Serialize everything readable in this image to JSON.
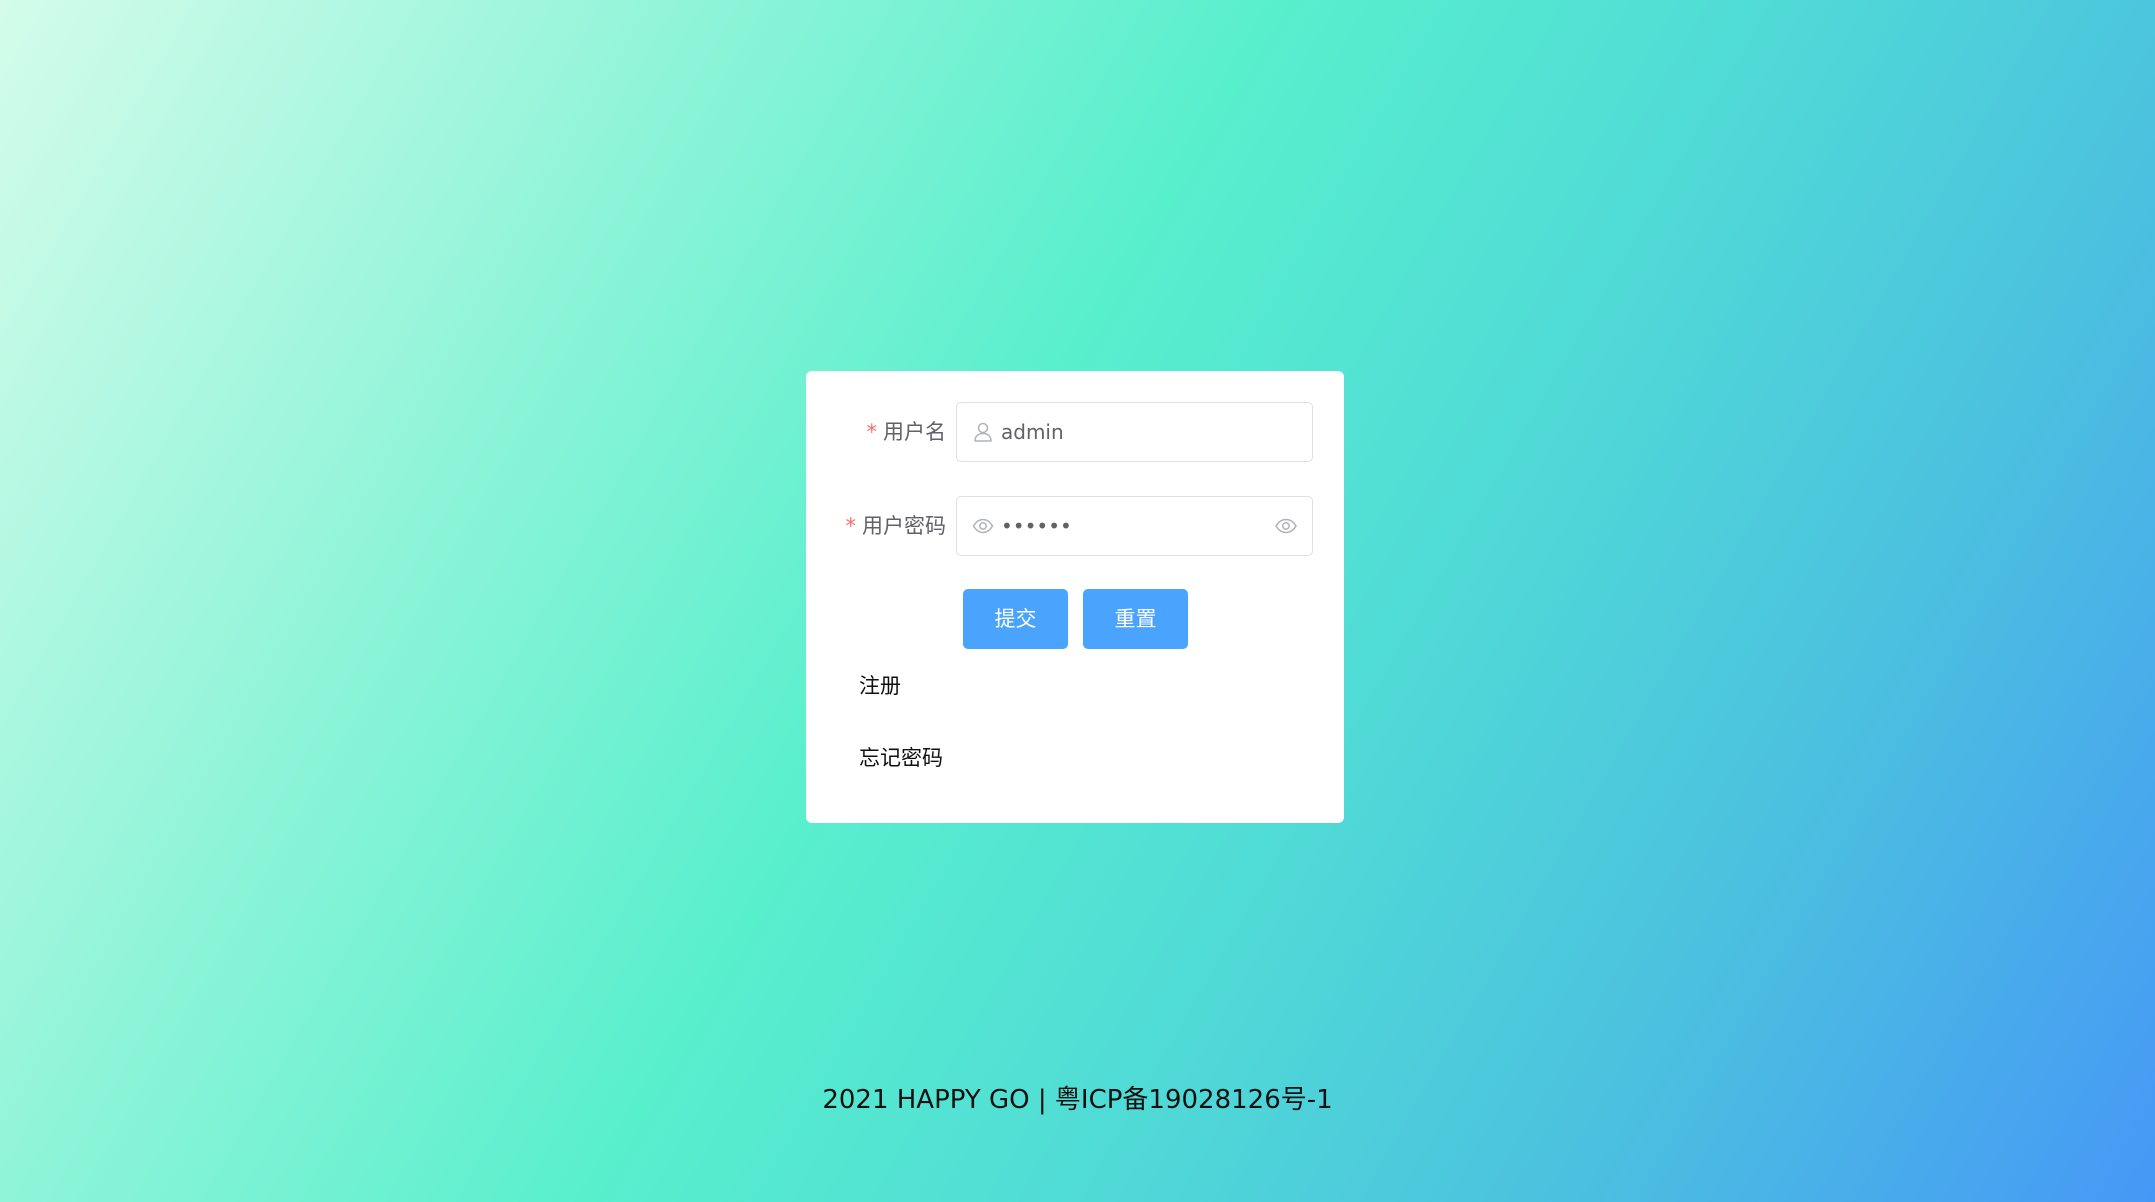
{
  "login_form": {
    "username": {
      "required_mark": "*",
      "label": "用户名",
      "value": "admin",
      "prefix_icon": "user-icon"
    },
    "password": {
      "required_mark": "*",
      "label": "用户密码",
      "value": "123456",
      "prefix_icon": "eye-icon",
      "suffix_icon": "eye-icon"
    },
    "buttons": {
      "submit_label": "提交",
      "reset_label": "重置"
    },
    "links": {
      "register_label": "注册",
      "forgot_password_label": "忘记密码"
    }
  },
  "footer": {
    "text": "2021 HAPPY GO | 粤ICP备19028126号-1"
  },
  "colors": {
    "primary": "#4aa3fd",
    "required": "#f56c6c",
    "label": "#606266",
    "border": "#dcdfe6"
  }
}
